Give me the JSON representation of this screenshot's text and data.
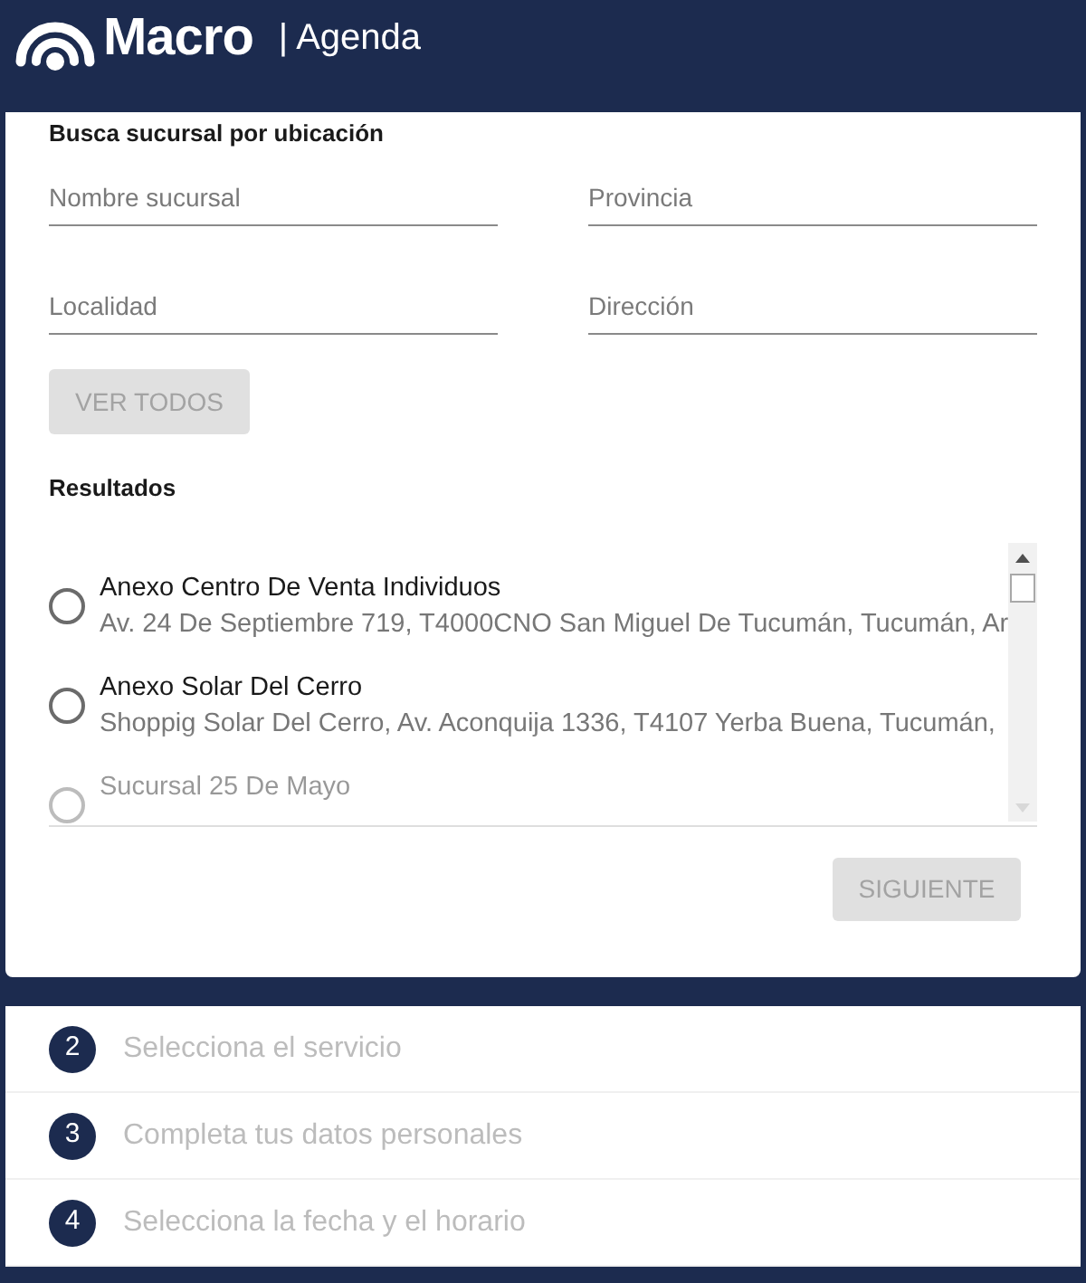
{
  "header": {
    "brand": "Macro",
    "section": "| Agenda"
  },
  "search": {
    "title": "Busca sucursal por ubicación",
    "fields": [
      {
        "placeholder": "Nombre sucursal"
      },
      {
        "placeholder": "Provincia"
      },
      {
        "placeholder": "Localidad"
      },
      {
        "placeholder": "Dirección"
      }
    ],
    "button": {
      "label": "VER TODOS",
      "disabled": true
    }
  },
  "results": {
    "title": "Resultados",
    "items": [
      {
        "name": "Anexo Centro De Venta Individuos",
        "address": "Av. 24 De Septiembre 719, T4000CNO San Miguel De Tucumán, Tucumán, Ar",
        "selected": false
      },
      {
        "name": "Anexo Solar Del Cerro",
        "address": "Shoppig Solar Del Cerro, Av. Aconquija 1336, T4107 Yerba Buena, Tucumán,",
        "selected": false
      },
      {
        "name": "Sucursal 25 De Mayo",
        "selected": false
      }
    ]
  },
  "next_button": {
    "label": "SIGUIENTE",
    "disabled": true
  },
  "steps": [
    {
      "number": "2",
      "label": "Selecciona el servicio",
      "disabled": true
    },
    {
      "number": "3",
      "label": "Completa tus datos personales",
      "disabled": true
    },
    {
      "number": "4",
      "label": "Selecciona la fecha y el horario",
      "disabled": true
    }
  ]
}
